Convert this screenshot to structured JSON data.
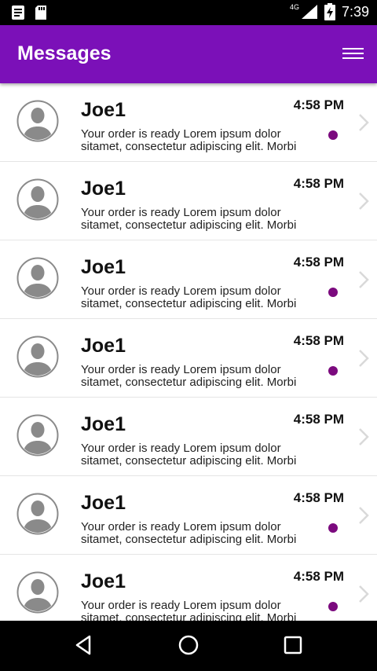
{
  "status_bar": {
    "network": "4G",
    "time": "7:39"
  },
  "app_bar": {
    "title": "Messages"
  },
  "messages": [
    {
      "name": "Joe1",
      "time": "4:58 PM",
      "preview": "Your order is ready Lorem ipsum dolor sitamet, consectetur adipiscing elit. Morbi",
      "unread": true
    },
    {
      "name": "Joe1",
      "time": "4:58 PM",
      "preview": "Your order is ready Lorem ipsum dolor sitamet, consectetur adipiscing elit. Morbi",
      "unread": false
    },
    {
      "name": "Joe1",
      "time": "4:58 PM",
      "preview": "Your order is ready Lorem ipsum dolor sitamet, consectetur adipiscing elit. Morbi",
      "unread": true
    },
    {
      "name": "Joe1",
      "time": "4:58 PM",
      "preview": "Your order is ready Lorem ipsum dolor sitamet, consectetur adipiscing elit. Morbi",
      "unread": true
    },
    {
      "name": "Joe1",
      "time": "4:58 PM",
      "preview": "Your order is ready Lorem ipsum dolor sitamet, consectetur adipiscing elit. Morbi",
      "unread": false
    },
    {
      "name": "Joe1",
      "time": "4:58 PM",
      "preview": "Your order is ready Lorem ipsum dolor sitamet, consectetur adipiscing elit. Morbi",
      "unread": true
    },
    {
      "name": "Joe1",
      "time": "4:58 PM",
      "preview": "Your order is ready Lorem ipsum dolor sitamet, consectetur adipiscing elit. Morbi",
      "unread": true
    }
  ],
  "colors": {
    "app_bar": "#7b10b8",
    "unread_dot": "#7b0a7e"
  },
  "icons": {
    "status_left": [
      "notes-icon",
      "sd-card-icon"
    ],
    "status_right": [
      "signal-icon",
      "battery-charging-icon"
    ],
    "menu": "menu-icon",
    "avatar": "person-avatar-icon",
    "row_chevron": "chevron-right-icon",
    "nav": [
      "back-icon",
      "home-icon",
      "recents-icon"
    ]
  }
}
